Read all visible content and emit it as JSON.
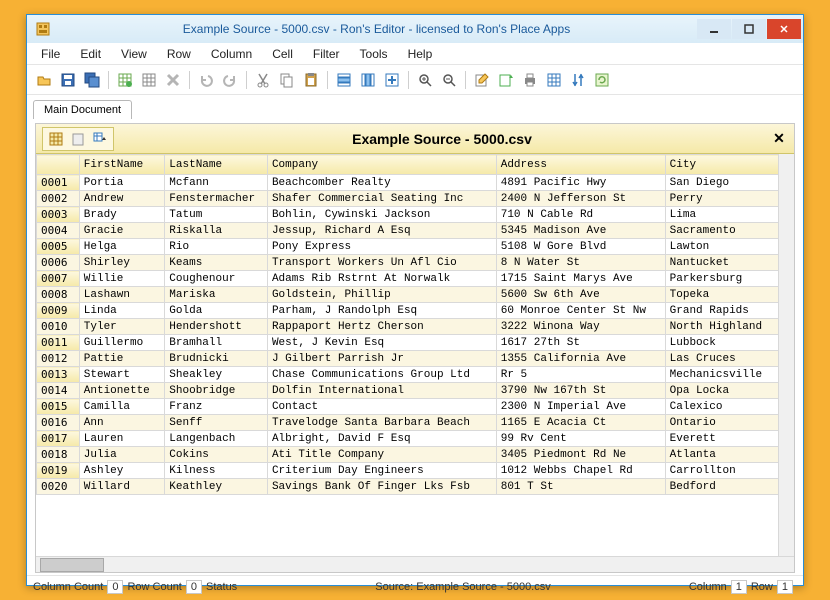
{
  "window": {
    "title": "Example Source - 5000.csv - Ron's Editor - licensed to Ron's Place Apps"
  },
  "menu": [
    "File",
    "Edit",
    "View",
    "Row",
    "Column",
    "Cell",
    "Filter",
    "Tools",
    "Help"
  ],
  "tab": {
    "label": "Main Document"
  },
  "doc": {
    "title": "Example Source - 5000.csv"
  },
  "columns": [
    "FirstName",
    "LastName",
    "Company",
    "Address",
    "City"
  ],
  "rows": [
    {
      "n": "0001",
      "c": [
        "Portia",
        "Mcfann",
        "Beachcomber Realty",
        "4891 Pacific Hwy",
        "San Diego"
      ]
    },
    {
      "n": "0002",
      "c": [
        "Andrew",
        "Fenstermacher",
        "Shafer Commercial Seating Inc",
        "2400 N Jefferson St",
        "Perry"
      ]
    },
    {
      "n": "0003",
      "c": [
        "Brady",
        "Tatum",
        "Bohlin, Cywinski Jackson",
        "710 N Cable Rd",
        "Lima"
      ]
    },
    {
      "n": "0004",
      "c": [
        "Gracie",
        "Riskalla",
        "Jessup, Richard A Esq",
        "5345 Madison Ave",
        "Sacramento"
      ]
    },
    {
      "n": "0005",
      "c": [
        "Helga",
        "Rio",
        "Pony Express",
        "5108 W Gore Blvd",
        "Lawton"
      ]
    },
    {
      "n": "0006",
      "c": [
        "Shirley",
        "Keams",
        "Transport Workers Un Afl Cio",
        "8 N Water St",
        "Nantucket"
      ]
    },
    {
      "n": "0007",
      "c": [
        "Willie",
        "Coughenour",
        "Adams Rib Rstrnt At Norwalk",
        "1715 Saint Marys Ave",
        "Parkersburg"
      ]
    },
    {
      "n": "0008",
      "c": [
        "Lashawn",
        "Mariska",
        "Goldstein, Phillip",
        "5600 Sw 6th Ave",
        "Topeka"
      ]
    },
    {
      "n": "0009",
      "c": [
        "Linda",
        "Golda",
        "Parham, J Randolph Esq",
        "60 Monroe Center St Nw",
        "Grand Rapids"
      ]
    },
    {
      "n": "0010",
      "c": [
        "Tyler",
        "Hendershott",
        "Rappaport Hertz Cherson",
        "3222 Winona Way",
        "North Highland"
      ]
    },
    {
      "n": "0011",
      "c": [
        "Guillermo",
        "Bramhall",
        "West, J Kevin Esq",
        "1617 27th St",
        "Lubbock"
      ]
    },
    {
      "n": "0012",
      "c": [
        "Pattie",
        "Brudnicki",
        "J Gilbert Parrish Jr",
        "1355 California Ave",
        "Las Cruces"
      ]
    },
    {
      "n": "0013",
      "c": [
        "Stewart",
        "Sheakley",
        "Chase Communications Group Ltd",
        "Rr 5",
        "Mechanicsville"
      ]
    },
    {
      "n": "0014",
      "c": [
        "Antionette",
        "Shoobridge",
        "Dolfin International",
        "3790 Nw 167th St",
        "Opa Locka"
      ]
    },
    {
      "n": "0015",
      "c": [
        "Camilla",
        "Franz",
        "Contact",
        "2300 N Imperial Ave",
        "Calexico"
      ]
    },
    {
      "n": "0016",
      "c": [
        "Ann",
        "Senff",
        "Travelodge Santa Barbara Beach",
        "1165 E Acacia Ct",
        "Ontario"
      ]
    },
    {
      "n": "0017",
      "c": [
        "Lauren",
        "Langenbach",
        "Albright, David F Esq",
        "99 Rv Cent",
        "Everett"
      ]
    },
    {
      "n": "0018",
      "c": [
        "Julia",
        "Cokins",
        "Ati Title Company",
        "3405 Piedmont Rd Ne",
        "Atlanta"
      ]
    },
    {
      "n": "0019",
      "c": [
        "Ashley",
        "Kilness",
        "Criterium Day Engineers",
        "1012 Webbs Chapel Rd",
        "Carrollton"
      ]
    },
    {
      "n": "0020",
      "c": [
        "Willard",
        "Keathley",
        "Savings Bank Of Finger Lks Fsb",
        "801 T St",
        "Bedford"
      ]
    }
  ],
  "status": {
    "colcount_label": "Column Count",
    "colcount": "0",
    "rowcount_label": "Row Count",
    "rowcount": "0",
    "status_label": "Status",
    "source": "Source: Example Source - 5000.csv",
    "column_label": "Column",
    "column": "1",
    "row_label": "Row",
    "row": "1"
  }
}
